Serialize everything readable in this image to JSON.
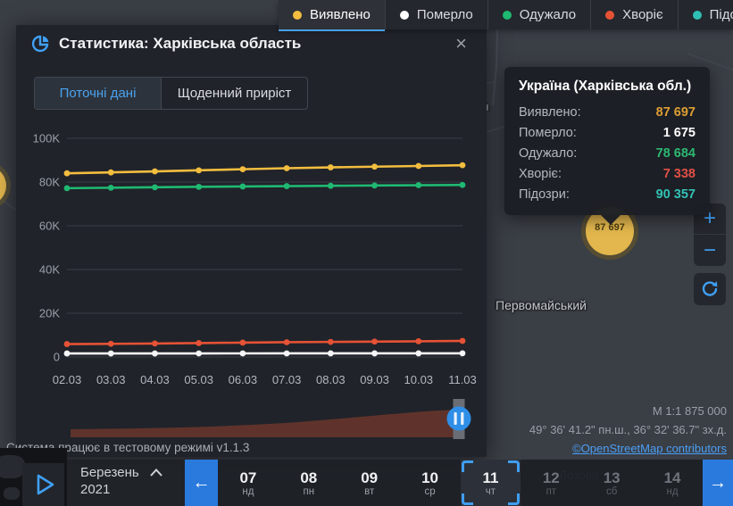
{
  "top_bar": {
    "legend": [
      {
        "label": "Виявлено",
        "color": "#f3bd3f",
        "active": true
      },
      {
        "label": "Померло",
        "color": "#ffffff",
        "active": false
      },
      {
        "label": "Одужало",
        "color": "#1fb972",
        "active": false
      },
      {
        "label": "Хворіє",
        "color": "#e55235",
        "active": false
      },
      {
        "label": "Підозри",
        "color": "#2fc0b4",
        "active": false
      }
    ]
  },
  "modal": {
    "title": "Статистика: Харківська область",
    "close_label": "×",
    "tabs": [
      {
        "label": "Поточні дані",
        "active": true
      },
      {
        "label": "Щоденний приріст",
        "active": false
      }
    ],
    "status_text": "Система працює в тестовому режимі v1.1.3"
  },
  "chart_data": {
    "type": "line",
    "title": "Статистика: Харківська область — Поточні дані",
    "x": [
      "02.03",
      "03.03",
      "04.03",
      "05.03",
      "06.03",
      "07.03",
      "08.03",
      "09.03",
      "10.03",
      "11.03"
    ],
    "series": [
      {
        "name": "Виявлено",
        "color": "#f3bd3f",
        "values": [
          84012,
          84420,
          84890,
          85370,
          85870,
          86330,
          86720,
          87040,
          87350,
          87697
        ]
      },
      {
        "name": "Одужало",
        "color": "#1fb972",
        "values": [
          77190,
          77400,
          77610,
          77820,
          77990,
          78140,
          78290,
          78430,
          78560,
          78684
        ]
      },
      {
        "name": "Хворіє",
        "color": "#e55235",
        "values": [
          5890,
          6010,
          6160,
          6350,
          6560,
          6740,
          6890,
          7030,
          7180,
          7338
        ]
      },
      {
        "name": "Померло",
        "color": "#f5f6f7",
        "values": [
          1601,
          1609,
          1617,
          1625,
          1633,
          1641,
          1649,
          1657,
          1666,
          1675
        ]
      }
    ],
    "ylim": [
      0,
      100000
    ],
    "yticks": [
      {
        "value": 0,
        "label": "0"
      },
      {
        "value": 20000,
        "label": "20K"
      },
      {
        "value": 40000,
        "label": "40K"
      },
      {
        "value": 60000,
        "label": "60K"
      },
      {
        "value": 80000,
        "label": "80K"
      },
      {
        "value": 100000,
        "label": "100K"
      }
    ],
    "grid": true,
    "legend_position": "top-bar",
    "preview_color": "#5f332b"
  },
  "tooltip": {
    "title": "Україна (Харківська обл.)",
    "rows": [
      {
        "label": "Виявлено:",
        "value": "87 697",
        "color": "#de9f33"
      },
      {
        "label": "Померло:",
        "value": "1 675",
        "color": "#ffffff"
      },
      {
        "label": "Одужало:",
        "value": "78 684",
        "color": "#2db873"
      },
      {
        "label": "Хворіє:",
        "value": "7 338",
        "color": "#e25047"
      },
      {
        "label": "Підозри:",
        "value": "90 357",
        "color": "#33c1b5"
      }
    ]
  },
  "map": {
    "marker_value": "87 697",
    "labels": {
      "partial_town": "тин",
      "town1": "Первомайський",
      "town2": "Лозова"
    },
    "scale": "М 1:1 875 000",
    "coordinates": "49° 36' 41.2\" пн.ш., 36° 32' 36.7\" зх.д.",
    "attribution": "©OpenStreetMap contributors"
  },
  "timeline": {
    "month": "Березень",
    "year": "2021",
    "days": [
      {
        "num": "07",
        "dow": "нд",
        "selected": false,
        "dimmed": false
      },
      {
        "num": "08",
        "dow": "пн",
        "selected": false,
        "dimmed": false
      },
      {
        "num": "09",
        "dow": "вт",
        "selected": false,
        "dimmed": false
      },
      {
        "num": "10",
        "dow": "ср",
        "selected": false,
        "dimmed": false
      },
      {
        "num": "11",
        "dow": "чт",
        "selected": true,
        "dimmed": false
      },
      {
        "num": "12",
        "dow": "пт",
        "selected": false,
        "dimmed": true
      },
      {
        "num": "13",
        "dow": "сб",
        "selected": false,
        "dimmed": true
      },
      {
        "num": "14",
        "dow": "нд",
        "selected": false,
        "dimmed": true
      }
    ]
  }
}
